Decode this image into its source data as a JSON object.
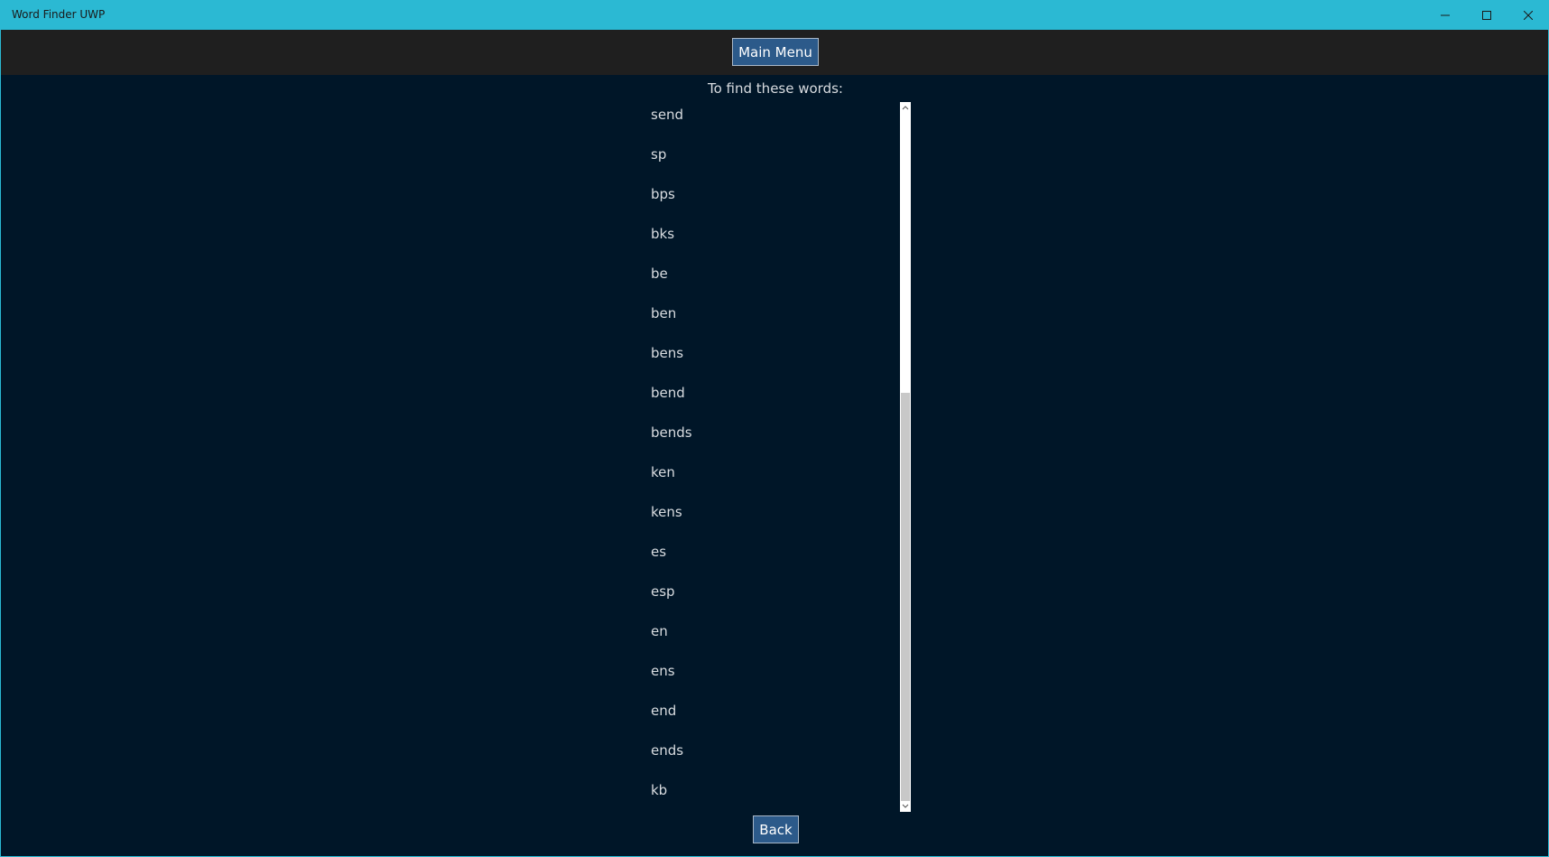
{
  "window": {
    "title": "Word Finder UWP"
  },
  "toolbar": {
    "main_menu_label": "Main Menu"
  },
  "content": {
    "prompt": "To find these words:",
    "words": [
      "send",
      "sp",
      "bps",
      "bks",
      "be",
      "ben",
      "bens",
      "bend",
      "bends",
      "ken",
      "kens",
      "es",
      "esp",
      "en",
      "ens",
      "end",
      "ends",
      "kb"
    ]
  },
  "scrollbar": {
    "thumb_start_fraction": 0.41,
    "thumb_end_fraction": 0.985
  },
  "footer": {
    "back_label": "Back"
  },
  "colors": {
    "titlebar": "#2bb9d3",
    "toolbar": "#1f1f1f",
    "background": "#001628",
    "button": "#2c5a8a",
    "text": "#d8dce0"
  },
  "icons": {
    "minimize": "minimize-icon",
    "maximize": "maximize-icon",
    "close": "close-icon",
    "scroll_up": "chevron-up-icon",
    "scroll_down": "chevron-down-icon"
  }
}
